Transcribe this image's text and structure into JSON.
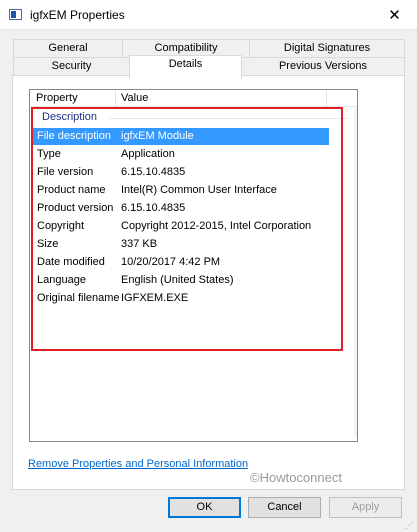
{
  "window": {
    "title": "igfxEM Properties",
    "close_glyph": "✕"
  },
  "tabs_top": [
    "General",
    "Compatibility",
    "Digital Signatures"
  ],
  "tabs_bottom": [
    "Security",
    "Details",
    "Previous Versions"
  ],
  "active_tab": "Details",
  "details": {
    "columns": [
      "Property",
      "Value"
    ],
    "group": "Description",
    "rows": [
      {
        "key": "File description",
        "value": "igfxEM Module"
      },
      {
        "key": "Type",
        "value": "Application"
      },
      {
        "key": "File version",
        "value": "6.15.10.4835"
      },
      {
        "key": "Product name",
        "value": "Intel(R) Common User Interface"
      },
      {
        "key": "Product version",
        "value": "6.15.10.4835"
      },
      {
        "key": "Copyright",
        "value": "Copyright 2012-2015, Intel Corporation"
      },
      {
        "key": "Size",
        "value": "337 KB"
      },
      {
        "key": "Date modified",
        "value": "10/20/2017 4:42 PM"
      },
      {
        "key": "Language",
        "value": "English (United States)"
      },
      {
        "key": "Original filename",
        "value": "IGFXEM.EXE"
      }
    ]
  },
  "remove_link": "Remove Properties and Personal Information",
  "watermark": "©Howtoconnect",
  "buttons": {
    "ok": "OK",
    "cancel": "Cancel",
    "apply": "Apply"
  },
  "colors": {
    "selection": "#3399ff",
    "highlight_box": "#e11d25",
    "link": "#0066cc"
  }
}
